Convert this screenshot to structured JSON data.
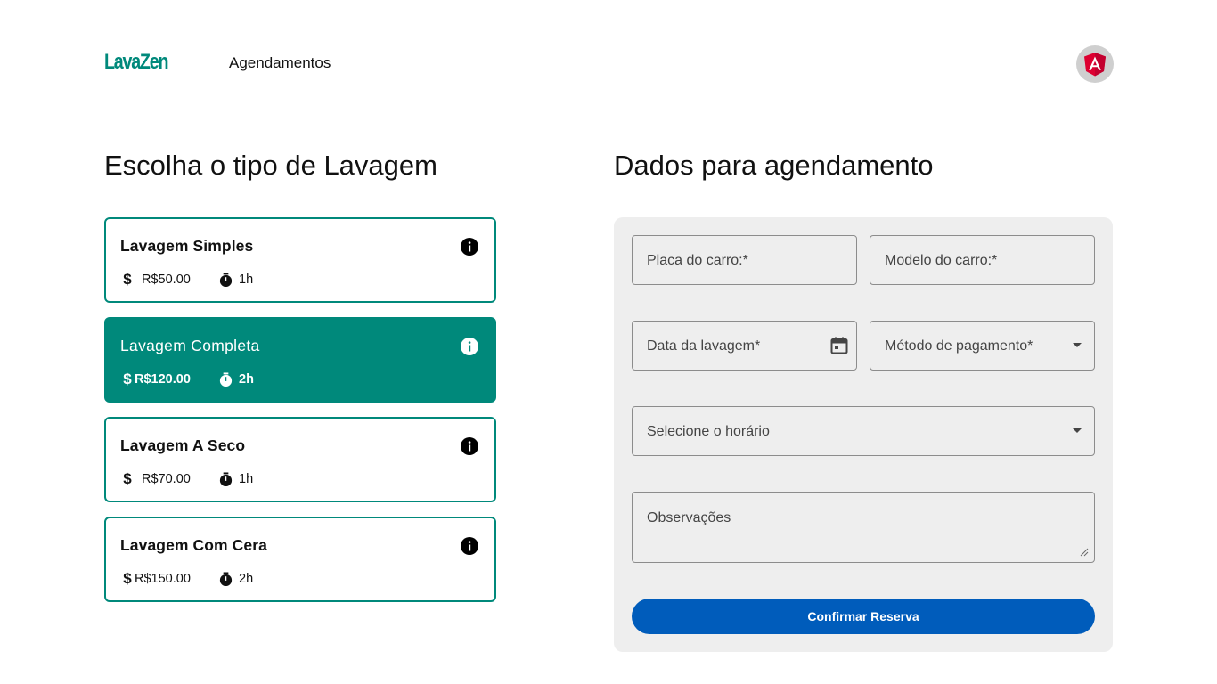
{
  "header": {
    "logo": "LavaZen",
    "nav_link": "Agendamentos",
    "avatar_icon": "angular-logo-icon"
  },
  "left": {
    "title": "Escolha o tipo de Lavagem",
    "cards": [
      {
        "name": "Lavagem Simples",
        "price": "R$50.00",
        "duration": "1h",
        "selected": false
      },
      {
        "name": "Lavagem Completa",
        "price": "R$120.00",
        "duration": "2h",
        "selected": true
      },
      {
        "name": "Lavagem A Seco",
        "price": "R$70.00",
        "duration": "1h",
        "selected": false
      },
      {
        "name": "Lavagem Com Cera",
        "price": "R$150.00",
        "duration": "2h",
        "selected": false
      }
    ],
    "currency_symbol": "$"
  },
  "form": {
    "title": "Dados para agendamento",
    "plate_label": "Placa do carro:*",
    "model_label": "Modelo do carro:*",
    "date_label": "Data da lavagem*",
    "payment_label": "Método de pagamento*",
    "time_label": "Selecione o horário",
    "notes_label": "Observações",
    "confirm_label": "Confirmar Reserva"
  },
  "colors": {
    "primary": "#00897b",
    "button": "#005cbb",
    "panel": "#eeeeee"
  }
}
